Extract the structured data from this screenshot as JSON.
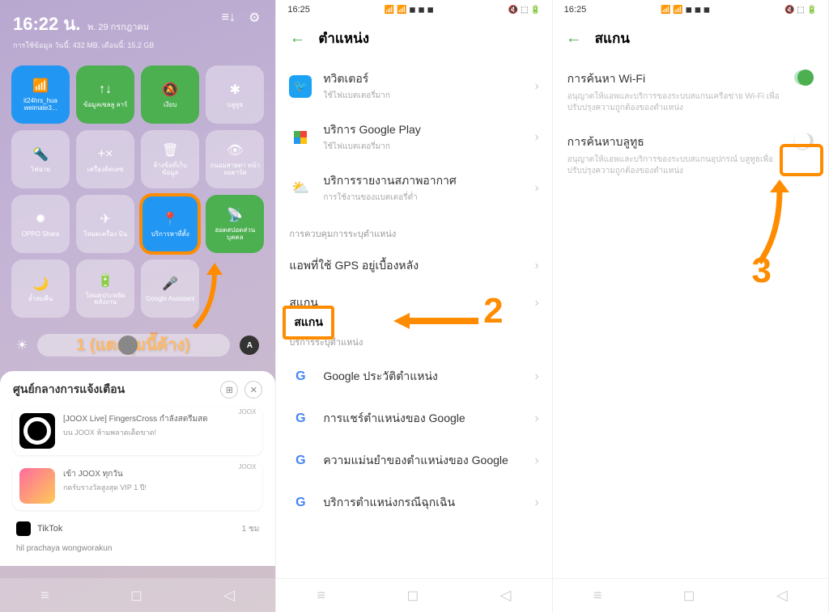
{
  "panel1": {
    "time": "16:22 น.",
    "date": "พ. 29 กรกฎาคม",
    "usage": "การใช้ข้อมูล วันนี้: 432 MB, เดือนนี้: 15.2 GB",
    "tiles": [
      {
        "label": "it24hrs_hua weimate3...",
        "icon": "📶"
      },
      {
        "label": "ข้อมูลเซลลู ลาร์",
        "icon": "↑↓"
      },
      {
        "label": "เงียบ",
        "icon": "🔕"
      },
      {
        "label": "บลูทูธ",
        "icon": "✱"
      },
      {
        "label": "ไฟฉาย",
        "icon": "🔦"
      },
      {
        "label": "เครื่องคิดเลข",
        "icon": "+×"
      },
      {
        "label": "ล้างข้อที่เก็บ ข้อมูล",
        "icon": "🗑"
      },
      {
        "label": "ถนอมสายตา หน้าจอดาร์ค",
        "icon": "👁"
      },
      {
        "label": "OPPO Share",
        "icon": "✹"
      },
      {
        "label": "โหมดเครื่อง บิน",
        "icon": "✈"
      },
      {
        "label": "บริการหาที่ตั้ง",
        "icon": "📍"
      },
      {
        "label": "ฮอตสปอตส่วนบุคคล",
        "icon": "📡"
      },
      {
        "label": "ล้ำสมคืน",
        "icon": "🌙"
      },
      {
        "label": "โหมดประหยัด พลังงาน",
        "icon": "🔋"
      },
      {
        "label": "Google Assistant",
        "icon": "🎤"
      }
    ],
    "brightness_icon": "☀",
    "auto_label": "A",
    "notif_title": "ศูนย์กลางการแจ้งเตือน",
    "joox_label": "JOOX",
    "notif1_line1": "[JOOX Live] FingersCross กำลังสตรีมสด",
    "notif1_line2": "บน JOOX ห้ามพลาดเด็ดขาด!",
    "notif2_line1": "เข้า JOOX ทุกวัน",
    "notif2_line2": "กดรับรางวัลสูงสุด VIP 1 ปี!",
    "tiktok_label": "TikTok",
    "tiktok_time": "1 ชม",
    "cutoff": "hil prachaya wongworakun",
    "annotation": "1 (แตะปุ่มนี้ค้าง)"
  },
  "panel2": {
    "status_time": "16:25",
    "title": "ตำแหน่ง",
    "items_top": [
      {
        "title": "ทวิตเตอร์",
        "sub": "ใช้ไฟแบตเตอรี่มาก"
      },
      {
        "title": "บริการ Google Play",
        "sub": "ใช้ไฟแบตเตอรี่มาก"
      },
      {
        "title": "บริการรายงานสภาพอากาศ",
        "sub": "การใช้งานของแบตเตอรี่ต่ำ"
      }
    ],
    "section1": "การควบคุมการระบุตำแหน่ง",
    "gps_item": "แอพที่ใช้ GPS อยู่เบื้องหลัง",
    "scan_item": "สแกน",
    "section2": "บริการระบุตำแหน่ง",
    "google_items": [
      "Google ประวัติตำแหน่ง",
      "การแชร์ตำแหน่งของ Google",
      "ความแม่นยำของตำแหน่งของ Google",
      "บริการตำแหน่งกรณีฉุกเฉิน"
    ],
    "annotation": "2"
  },
  "panel3": {
    "status_time": "16:25",
    "title": "สแกน",
    "wifi_title": "การค้นหา Wi-Fi",
    "wifi_desc": "อนุญาตให้แอพและบริการของระบบสแกนเครือข่าย Wi-Fi เพื่อปรับปรุงความถูกต้องของตำแหน่ง",
    "bt_title": "การค้นหาบลูทูธ",
    "bt_desc": "อนุญาตให้แอพและบริการของระบบสแกนอุปกรณ์ บลูทูธเพื่อปรับปรุงความถูกต้องของตำแหน่ง",
    "annotation": "3"
  }
}
